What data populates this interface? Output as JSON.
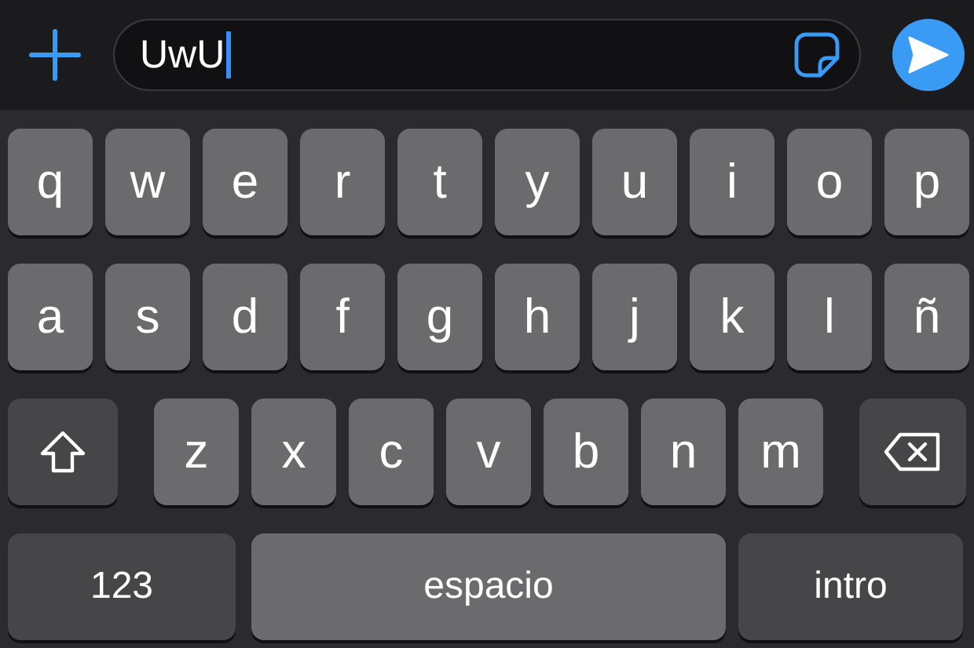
{
  "composer": {
    "value": "UwU",
    "cursor": true
  },
  "keyboard": {
    "letter_rows": [
      [
        {
          "kind": "letter",
          "label": "q"
        },
        {
          "kind": "letter",
          "label": "w"
        },
        {
          "kind": "letter",
          "label": "e"
        },
        {
          "kind": "letter",
          "label": "r"
        },
        {
          "kind": "letter",
          "label": "t"
        },
        {
          "kind": "letter",
          "label": "y"
        },
        {
          "kind": "letter",
          "label": "u"
        },
        {
          "kind": "letter",
          "label": "i"
        },
        {
          "kind": "letter",
          "label": "o"
        },
        {
          "kind": "letter",
          "label": "p"
        }
      ],
      [
        {
          "kind": "letter",
          "label": "a"
        },
        {
          "kind": "letter",
          "label": "s"
        },
        {
          "kind": "letter",
          "label": "d"
        },
        {
          "kind": "letter",
          "label": "f"
        },
        {
          "kind": "letter",
          "label": "g"
        },
        {
          "kind": "letter",
          "label": "h"
        },
        {
          "kind": "letter",
          "label": "j"
        },
        {
          "kind": "letter",
          "label": "k"
        },
        {
          "kind": "letter",
          "label": "l"
        },
        {
          "kind": "letter",
          "label": "ñ"
        }
      ],
      [
        {
          "kind": "shift"
        },
        {
          "kind": "letter",
          "label": "z"
        },
        {
          "kind": "letter",
          "label": "x"
        },
        {
          "kind": "letter",
          "label": "c"
        },
        {
          "kind": "letter",
          "label": "v"
        },
        {
          "kind": "letter",
          "label": "b"
        },
        {
          "kind": "letter",
          "label": "n"
        },
        {
          "kind": "letter",
          "label": "m"
        },
        {
          "kind": "backspace"
        }
      ]
    ],
    "bottom_row": {
      "numbers_key": "123",
      "space_key": "espacio",
      "return_key": "intro"
    }
  }
}
